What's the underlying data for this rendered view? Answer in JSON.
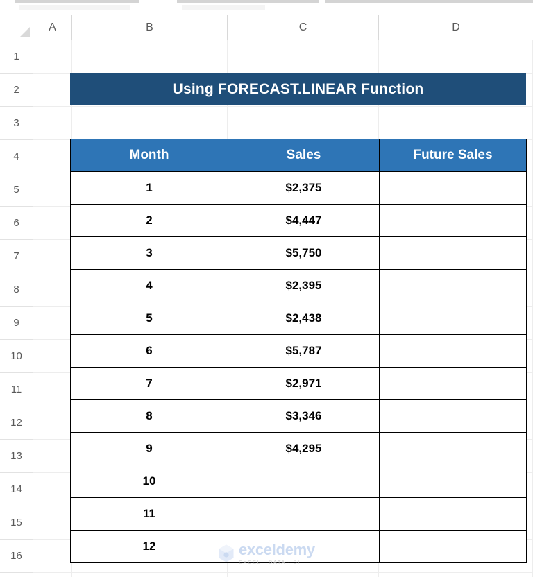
{
  "app": {
    "type": "spreadsheet",
    "ribbon_visible": false
  },
  "grid": {
    "column_headers": [
      "A",
      "B",
      "C",
      "D"
    ],
    "row_headers": [
      "1",
      "2",
      "3",
      "4",
      "5",
      "6",
      "7",
      "8",
      "9",
      "10",
      "11",
      "12",
      "13",
      "14",
      "15",
      "16"
    ],
    "select_all_icon": "select-all-triangle-icon"
  },
  "title_banner": {
    "text": "Using FORECAST.LINEAR Function",
    "cell_range": "B2:D2",
    "background_color": "#1F4E79",
    "text_color": "#FFFFFF"
  },
  "table": {
    "header_background_color": "#2E75B6",
    "header_text_color": "#FFFFFF",
    "border_color": "#000000",
    "columns": [
      "Month",
      "Sales",
      "Future Sales"
    ],
    "rows": [
      {
        "month": "1",
        "sales": "$2,375",
        "future_sales": ""
      },
      {
        "month": "2",
        "sales": "$4,447",
        "future_sales": ""
      },
      {
        "month": "3",
        "sales": "$5,750",
        "future_sales": ""
      },
      {
        "month": "4",
        "sales": "$2,395",
        "future_sales": ""
      },
      {
        "month": "5",
        "sales": "$2,438",
        "future_sales": ""
      },
      {
        "month": "6",
        "sales": "$5,787",
        "future_sales": ""
      },
      {
        "month": "7",
        "sales": "$2,971",
        "future_sales": ""
      },
      {
        "month": "8",
        "sales": "$3,346",
        "future_sales": ""
      },
      {
        "month": "9",
        "sales": "$4,295",
        "future_sales": ""
      },
      {
        "month": "10",
        "sales": "",
        "future_sales": ""
      },
      {
        "month": "11",
        "sales": "",
        "future_sales": ""
      },
      {
        "month": "12",
        "sales": "",
        "future_sales": ""
      }
    ]
  },
  "watermark": {
    "name": "exceldemy",
    "subtitle": "EXCEL · DATA · BI",
    "logo_icon": "exceldemy-hexagon-logo-icon",
    "name_color": "#C3D4EF",
    "subtitle_color": "#C9C9C9"
  }
}
